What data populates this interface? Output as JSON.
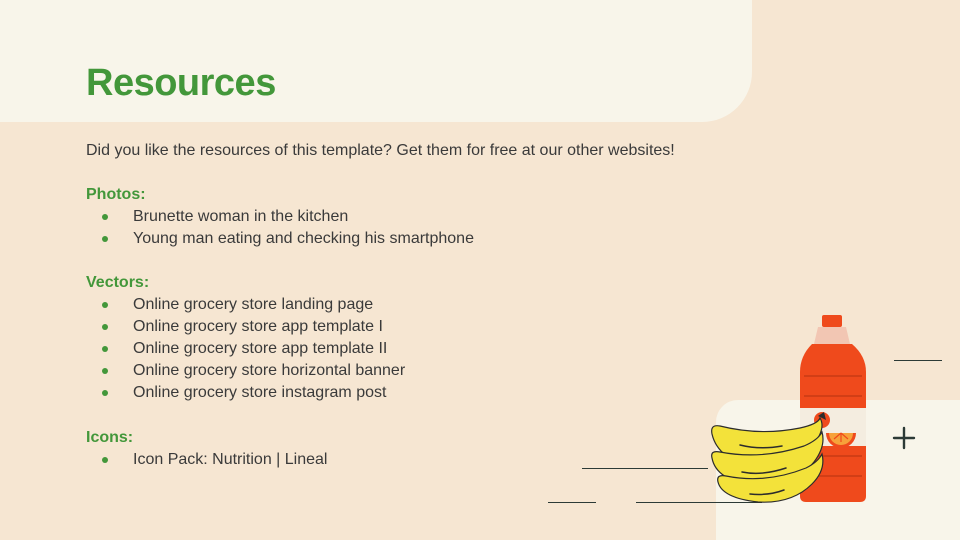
{
  "title": "Resources",
  "intro": "Did you like the resources of this template? Get them for free at our other websites!",
  "sections": [
    {
      "label": "Photos:",
      "items": [
        "Brunette woman in the kitchen",
        "Young man eating and checking his smartphone"
      ]
    },
    {
      "label": "Vectors:",
      "items": [
        "Online grocery store landing page",
        "Online grocery store app template I",
        "Online grocery store app template II",
        "Online grocery store horizontal banner",
        "Online grocery store instagram post"
      ]
    },
    {
      "label": "Icons:",
      "items": [
        "Icon Pack: Nutrition | Lineal"
      ]
    }
  ],
  "colors": {
    "accent_green": "#43973a",
    "background": "#f6e6d2",
    "panel": "#f8f5ea",
    "text": "#3a3a3a",
    "bottle_orange": "#ef4a1c",
    "banana_yellow": "#f3e23a"
  },
  "icons": [
    "plus-icon",
    "banana-illustration",
    "juice-bottle-illustration"
  ]
}
